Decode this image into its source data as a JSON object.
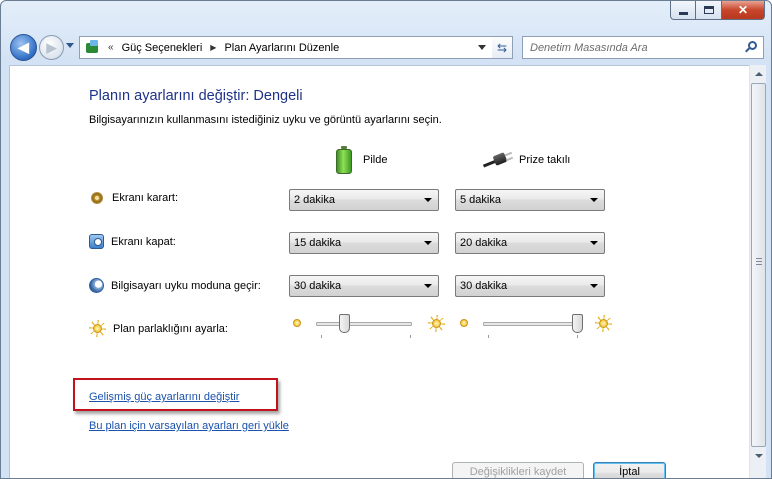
{
  "window": {
    "caption_buttons": {
      "minimize": "minimize-icon",
      "maximize": "maximize-icon",
      "close": "✕"
    }
  },
  "nav": {
    "back_icon": "back-arrow-icon",
    "forward_icon": "forward-arrow-icon",
    "overflow_chevron": "«",
    "breadcrumbs": [
      "Güç Seçenekleri",
      "Plan Ayarlarını Düzenle"
    ],
    "crumb_separator": "▶",
    "refresh_icon": "⇆",
    "search_placeholder": "Denetim Masasında Ara"
  },
  "page": {
    "title": "Planın ayarlarını değiştir: Dengeli",
    "subtitle": "Bilgisayarınızın kullanmasını istediğiniz uyku ve görüntü ayarlarını seçin.",
    "columns": {
      "battery": {
        "label": "Pilde",
        "icon": "battery-icon"
      },
      "plugged": {
        "label": "Prize takılı",
        "icon": "power-plug-icon"
      }
    },
    "rows": {
      "dim": {
        "label": "Ekranı karart:",
        "battery": "2 dakika",
        "plugged": "5 dakika",
        "icon": "dim-display-icon"
      },
      "off": {
        "label": "Ekranı kapat:",
        "battery": "15 dakika",
        "plugged": "20 dakika",
        "icon": "display-off-icon"
      },
      "sleep": {
        "label": "Bilgisayarı uyku moduna geçir:",
        "battery": "30 dakika",
        "plugged": "30 dakika",
        "icon": "sleep-moon-icon"
      },
      "brightness": {
        "label": "Plan parlaklığını ayarla:",
        "battery_level": 0.3,
        "plugged_level": 1.0,
        "icon": "brightness-sun-icon"
      }
    },
    "links": {
      "advanced": "Gelişmiş güç ayarlarını değiştir",
      "restore": "Bu plan için varsayılan ayarları geri yükle"
    },
    "buttons": {
      "save": "Değişiklikleri kaydet",
      "cancel": "İptal"
    }
  },
  "colors": {
    "title": "#1e3287",
    "link": "#1a52ad",
    "highlight": "#c0131c"
  }
}
